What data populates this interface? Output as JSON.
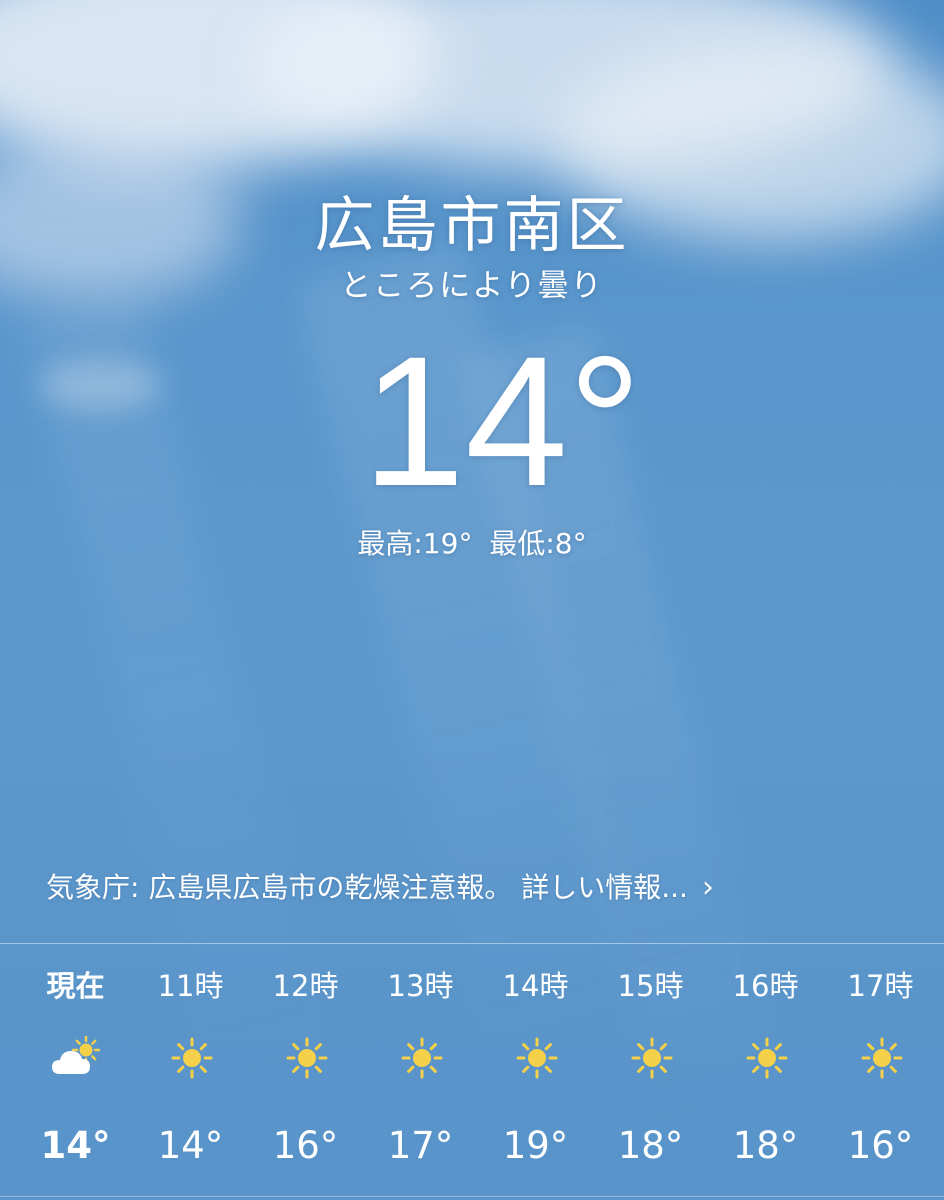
{
  "location": {
    "city": "広島市南区",
    "condition": "ところにより曇り",
    "temperature": "14°",
    "high": "最高:19°",
    "low": "最低:8°"
  },
  "alert": {
    "text": "気象庁: 広島県広島市の乾燥注意報。 詳しい情報...",
    "chevron": "›"
  },
  "hourly": [
    {
      "label": "現在",
      "icon": "partly-cloudy-icon",
      "temp": "14°"
    },
    {
      "label": "11時",
      "icon": "sun-icon",
      "temp": "14°"
    },
    {
      "label": "12時",
      "icon": "sun-icon",
      "temp": "16°"
    },
    {
      "label": "13時",
      "icon": "sun-icon",
      "temp": "17°"
    },
    {
      "label": "14時",
      "icon": "sun-icon",
      "temp": "19°"
    },
    {
      "label": "15時",
      "icon": "sun-icon",
      "temp": "18°"
    },
    {
      "label": "16時",
      "icon": "sun-icon",
      "temp": "18°"
    },
    {
      "label": "17時",
      "icon": "sun-icon",
      "temp": "16°"
    }
  ],
  "colors": {
    "sky": "#5b97cc",
    "sun": "#f5d14a",
    "cloud": "#ffffff",
    "text": "#ffffff"
  }
}
